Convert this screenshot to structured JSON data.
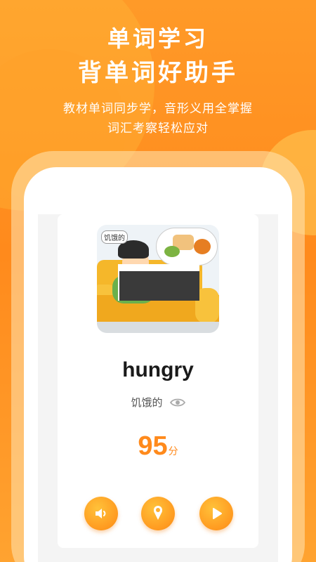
{
  "header": {
    "title_line1": "单词学习",
    "title_line2": "背单词好助手",
    "subtitle_line1": "教材单词同步学，音形义用全掌握",
    "subtitle_line2": "词汇考察轻松应对"
  },
  "card": {
    "image_tag": "饥饿的",
    "word": "hungry",
    "meaning": "饥饿的",
    "score": "95",
    "score_unit": "分"
  },
  "icons": {
    "eye": "eye-icon",
    "sound": "speaker-icon",
    "record": "microphone-icon",
    "play": "play-icon"
  },
  "colors": {
    "accent": "#ff8a1c",
    "button": "#ffa628",
    "text_dark": "#1a1a1a"
  }
}
